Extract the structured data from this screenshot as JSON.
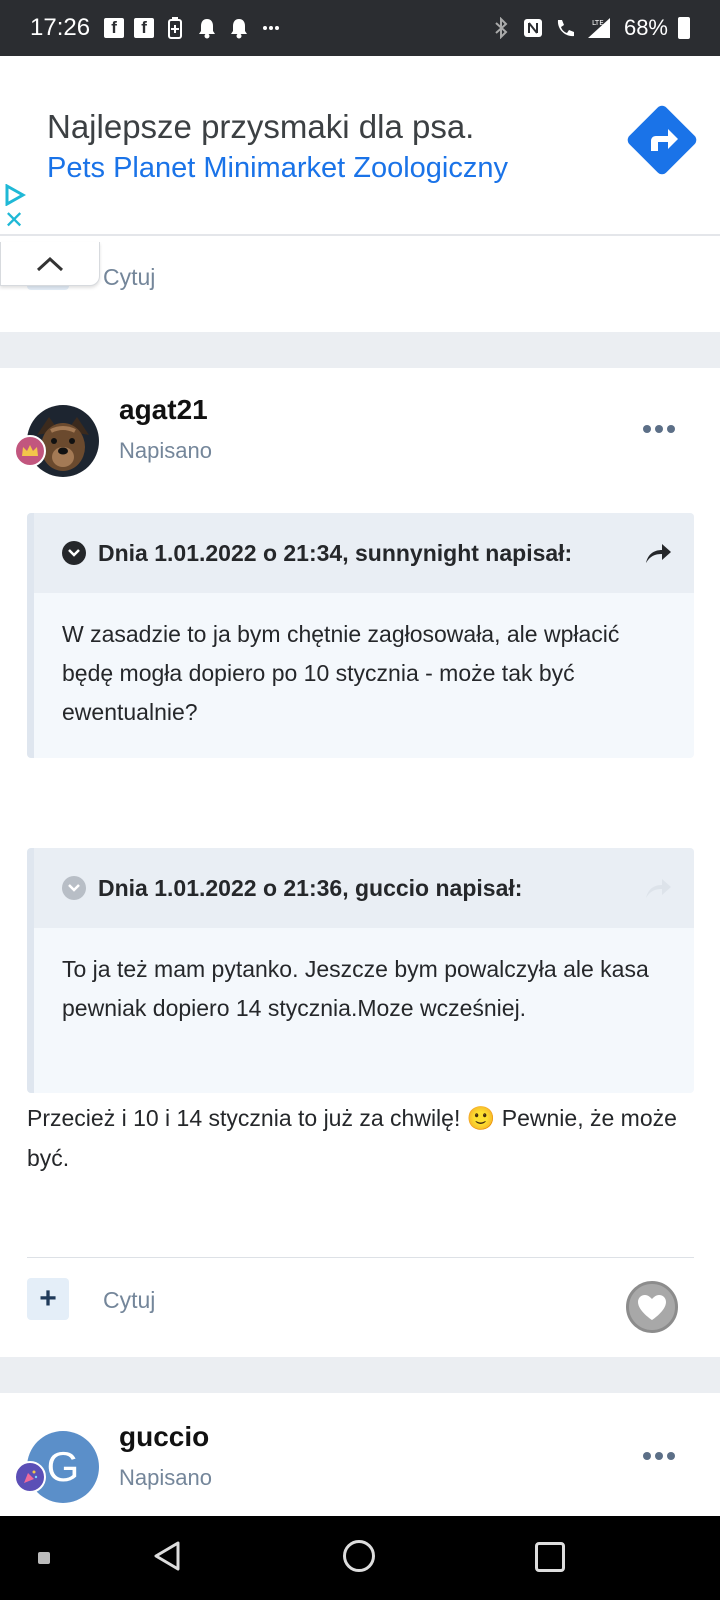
{
  "status_bar": {
    "time": "17:26",
    "battery": "68%",
    "lte": "LTE"
  },
  "ad": {
    "title": "Najlepsze przysmaki dla psa.",
    "subtitle": "Pets Planet Minimarket Zoologiczny"
  },
  "prev_post": {
    "quote_label": "Cytuj"
  },
  "post": {
    "username": "agat21",
    "posted_label": "Napisano",
    "quotes": [
      {
        "header": "Dnia 1.01.2022 o 21:34, sunnynight napisał:",
        "body": "W zasadzie to ja bym chętnie zagłosowała, ale wpłacić będę mogła dopiero po 10 stycznia - może tak być ewentualnie?"
      },
      {
        "header": "Dnia 1.01.2022 o 21:36, guccio napisał:",
        "body": "To ja też mam pytanko. Jeszcze bym powalczyła ale kasa pewniak dopiero 14 stycznia.Moze wcześniej."
      }
    ],
    "text": "Przecież i 10 i 14 stycznia to już za chwilę! 🙂 Pewnie, że może być.",
    "quote_label": "Cytuj",
    "plus_label": "+"
  },
  "next_post": {
    "username": "guccio",
    "posted_label": "Napisano",
    "avatar_letter": "G"
  },
  "colors": {
    "accent": "#1a73e8",
    "muted": "#74869a",
    "avatar_g": "#5b8fc9"
  }
}
